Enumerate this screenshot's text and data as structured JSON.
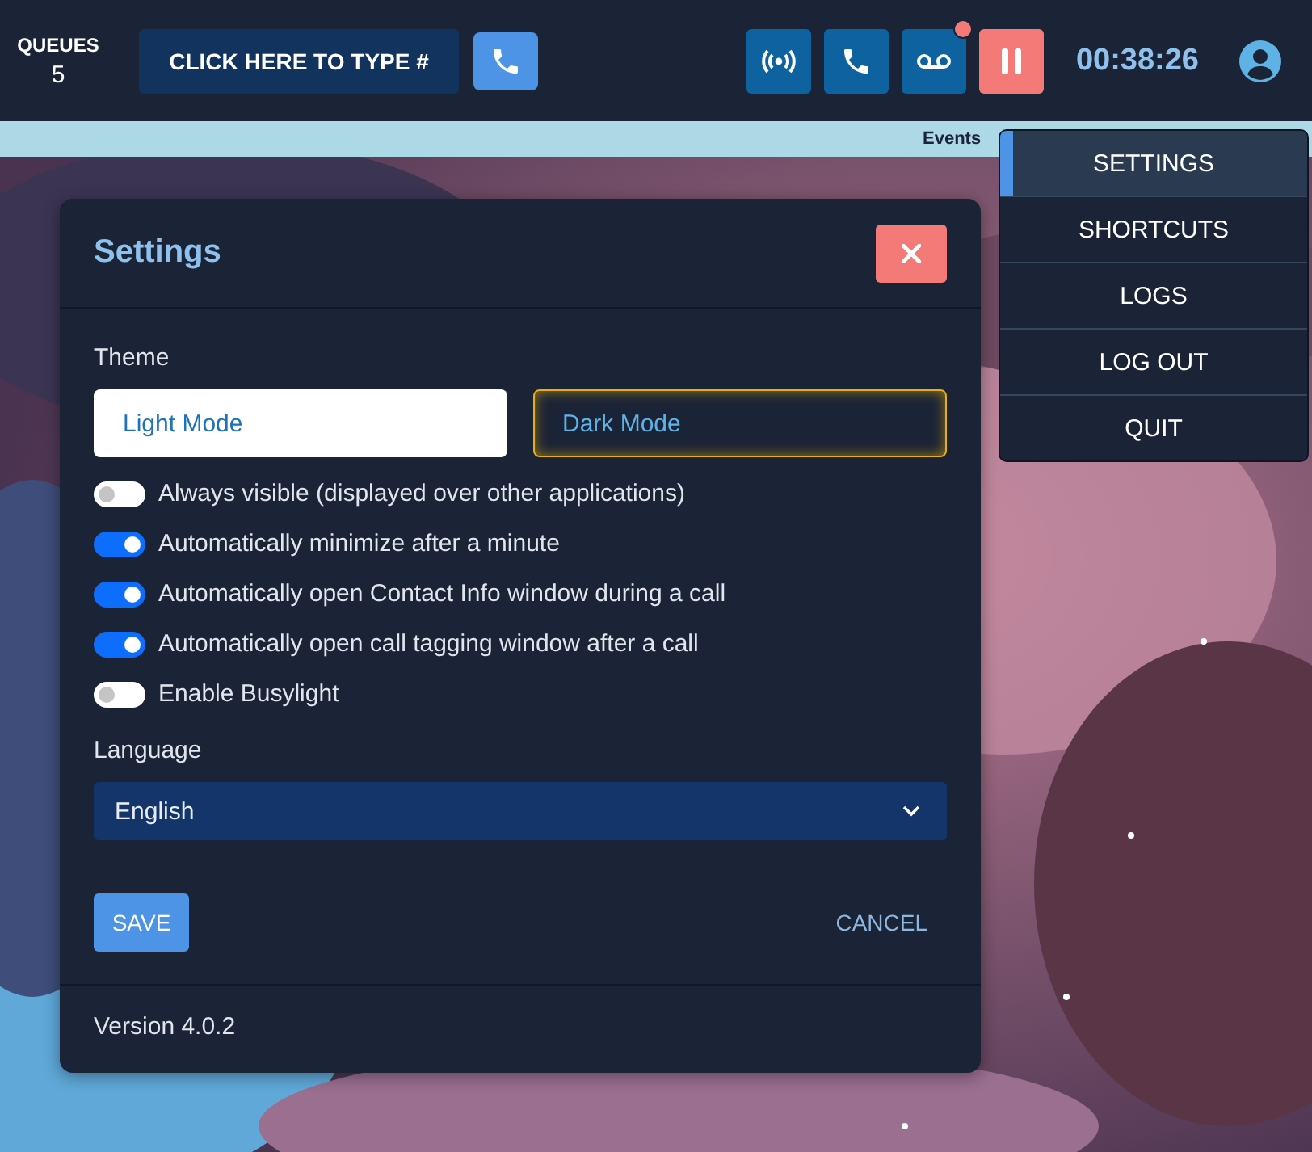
{
  "queues": {
    "label": "QUEUES",
    "count": "5"
  },
  "dial_button": "CLICK HERE TO TYPE #",
  "toolbar": [
    {
      "kind": "broadcast",
      "notification": false
    },
    {
      "kind": "phone",
      "notification": false
    },
    {
      "kind": "voicemail",
      "notification": true
    },
    {
      "kind": "pause",
      "notification": false
    }
  ],
  "timer": "00:38:26",
  "events_bar": {
    "label": "Events"
  },
  "menu": [
    {
      "label": "SETTINGS",
      "selected": true
    },
    {
      "label": "SHORTCUTS",
      "selected": false
    },
    {
      "label": "LOGS",
      "selected": false
    },
    {
      "label": "LOG OUT",
      "selected": false
    },
    {
      "label": "QUIT",
      "selected": false
    }
  ],
  "settings": {
    "title": "Settings",
    "theme_label": "Theme",
    "themes": [
      {
        "label": "Light Mode",
        "selected": false
      },
      {
        "label": "Dark Mode",
        "selected": true
      }
    ],
    "options": [
      {
        "label": "Always visible (displayed over other applications)",
        "on": false
      },
      {
        "label": "Automatically minimize after a minute",
        "on": true
      },
      {
        "label": "Automatically open Contact Info window during a call",
        "on": true
      },
      {
        "label": "Automatically open call tagging window after a call",
        "on": true
      },
      {
        "label": "Enable Busylight",
        "on": false
      }
    ],
    "language_label": "Language",
    "language": "English",
    "save": "SAVE",
    "cancel": "CANCEL",
    "version": "Version 4.0.2"
  }
}
